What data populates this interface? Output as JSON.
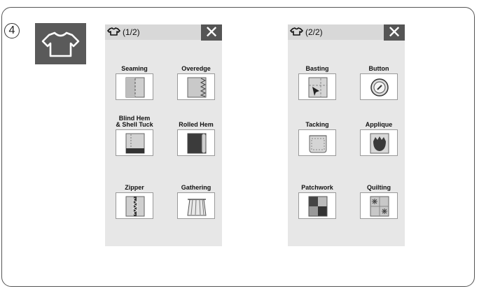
{
  "step_number": "4",
  "category_icon": "shirt-icon",
  "close_label": "✕",
  "panels": [
    {
      "page": "(1/2)",
      "items": [
        {
          "label": "Seaming",
          "icon": "seaming-icon"
        },
        {
          "label": "Overedge",
          "icon": "overedge-icon"
        },
        {
          "label": "Blind Hem\n& Shell Tuck",
          "icon": "blind-hem-icon"
        },
        {
          "label": "Rolled Hem",
          "icon": "rolled-hem-icon"
        },
        {
          "label": "Zipper",
          "icon": "zipper-icon"
        },
        {
          "label": "Gathering",
          "icon": "gathering-icon"
        }
      ]
    },
    {
      "page": "(2/2)",
      "items": [
        {
          "label": "Basting",
          "icon": "basting-icon"
        },
        {
          "label": "Button",
          "icon": "button-icon"
        },
        {
          "label": "Tacking",
          "icon": "tacking-icon"
        },
        {
          "label": "Applique",
          "icon": "applique-icon"
        },
        {
          "label": "Patchwork",
          "icon": "patchwork-icon"
        },
        {
          "label": "Quilting",
          "icon": "quilting-icon"
        }
      ]
    }
  ]
}
